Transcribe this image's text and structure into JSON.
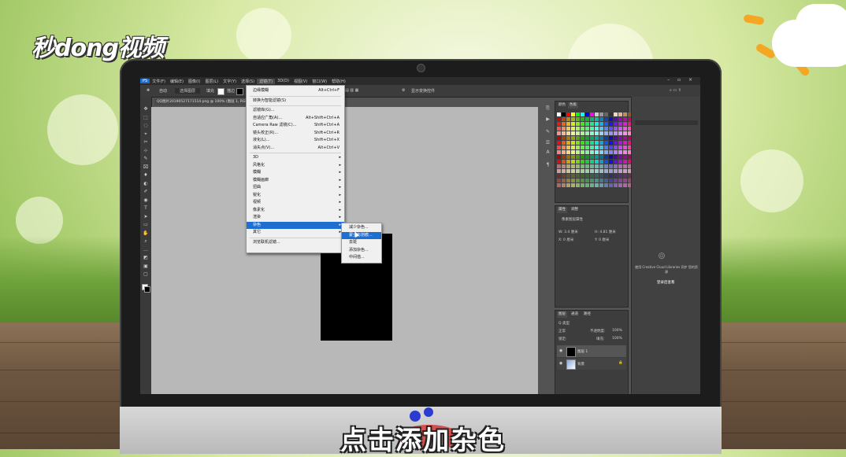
{
  "branding": {
    "logo_text": "秒dong视频"
  },
  "caption": "点击添加杂色",
  "photoshop": {
    "menubar": [
      "PS",
      "文件(F)",
      "编辑(E)",
      "图像(I)",
      "图层(L)",
      "文字(Y)",
      "选择(S)",
      "滤镜(T)",
      "3D(D)",
      "视图(V)",
      "窗口(W)",
      "帮助(H)"
    ],
    "active_menu_index": 7,
    "window_controls": "–  ▫  ×",
    "options_bar": {
      "auto_select_label": "自动",
      "layer_dropdown": "选择图层",
      "show_transform": "显示变换控件",
      "fill_label": "填充",
      "stroke_label": "描边"
    },
    "document_tab": "QQ图片20190527171514.png @ 100% (图层 1, RGB/8) *",
    "filter_menu": {
      "items": [
        {
          "label": "边缘模糊",
          "shortcut": "Alt+Ctrl+F",
          "arrow": false
        },
        {
          "sep": true
        },
        {
          "label": "转换为智能滤镜(S)",
          "shortcut": "",
          "arrow": false
        },
        {
          "sep": true
        },
        {
          "label": "滤镜库(G)...",
          "shortcut": "",
          "arrow": false
        },
        {
          "label": "自适应广角(A)...",
          "shortcut": "Alt+Shift+Ctrl+A",
          "arrow": false
        },
        {
          "label": "Camera Raw 滤镜(C)...",
          "shortcut": "Shift+Ctrl+A",
          "arrow": false
        },
        {
          "label": "镜头校正(R)...",
          "shortcut": "Shift+Ctrl+R",
          "arrow": false
        },
        {
          "label": "液化(L)...",
          "shortcut": "Shift+Ctrl+X",
          "arrow": false
        },
        {
          "label": "消失点(V)...",
          "shortcut": "Alt+Ctrl+V",
          "arrow": false
        },
        {
          "sep": true
        },
        {
          "label": "3D",
          "shortcut": "",
          "arrow": true
        },
        {
          "label": "风格化",
          "shortcut": "",
          "arrow": true
        },
        {
          "label": "模糊",
          "shortcut": "",
          "arrow": true
        },
        {
          "label": "模糊画廊",
          "shortcut": "",
          "arrow": true
        },
        {
          "label": "扭曲",
          "shortcut": "",
          "arrow": true
        },
        {
          "label": "锐化",
          "shortcut": "",
          "arrow": true
        },
        {
          "label": "视频",
          "shortcut": "",
          "arrow": true
        },
        {
          "label": "像素化",
          "shortcut": "",
          "arrow": true
        },
        {
          "label": "渲染",
          "shortcut": "",
          "arrow": true
        },
        {
          "label": "杂色",
          "shortcut": "",
          "arrow": true,
          "highlight": true
        },
        {
          "label": "其它",
          "shortcut": "",
          "arrow": true
        },
        {
          "sep": true
        },
        {
          "label": "浏览联机滤镜...",
          "shortcut": "",
          "arrow": false
        }
      ]
    },
    "noise_submenu": {
      "items": [
        {
          "label": "减少杂色..."
        },
        {
          "label": "蒙尘与划痕...",
          "highlight": true
        },
        {
          "label": "去斑"
        },
        {
          "label": "添加杂色..."
        },
        {
          "label": "中间值..."
        }
      ]
    },
    "panels": {
      "swatches_tabs": [
        "颜色",
        "色板"
      ],
      "properties_tabs": [
        "属性",
        "调整"
      ],
      "properties_title": "像素图层属性",
      "properties_fields": [
        "W: 3.4 厘米",
        "H: 4.81 厘米",
        "X: 0 厘米",
        "Y: 0 厘米"
      ],
      "layers_tabs": [
        "图层",
        "通道",
        "路径"
      ],
      "layer_kind": "Q 类型",
      "blend_mode": "正常",
      "opacity_label": "不透明度:",
      "opacity_value": "100%",
      "lock_label": "锁定:",
      "fill_label": "填充:",
      "fill_value": "100%",
      "layers": [
        {
          "name": "图层 1",
          "selected": true
        },
        {
          "name": "背景",
          "selected": false
        }
      ],
      "library_text": "使用 Creative Cloud Libraries 同步 您的资源",
      "library_link": "登录后查看"
    }
  },
  "colors": {
    "menu_highlight": "#1f6fd1",
    "ps_dark": "#2b2b2b",
    "panel": "#3d3d3d",
    "canvas_gray": "#b8b8b8"
  }
}
